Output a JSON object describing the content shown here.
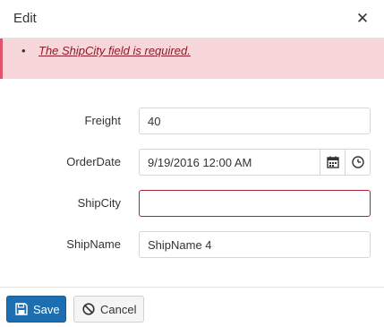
{
  "dialog": {
    "title": "Edit",
    "close_icon": "close-icon"
  },
  "validation": {
    "messages": [
      "The ShipCity field is required."
    ]
  },
  "form": {
    "freight": {
      "label": "Freight",
      "value": "40"
    },
    "order_date": {
      "label": "OrderDate",
      "value": "9/19/2016 12:00 AM",
      "calendar_icon": "calendar-icon",
      "clock_icon": "clock-icon"
    },
    "ship_city": {
      "label": "ShipCity",
      "value": ""
    },
    "ship_name": {
      "label": "ShipName",
      "value": "ShipName 4"
    }
  },
  "footer": {
    "save_label": "Save",
    "save_icon": "save-icon",
    "cancel_label": "Cancel",
    "cancel_icon": "cancel-icon"
  },
  "colors": {
    "primary": "#1c6eb0",
    "error_background": "#f8d7da",
    "error_border": "#e0556d",
    "invalid_field_border": "#b0243a"
  }
}
